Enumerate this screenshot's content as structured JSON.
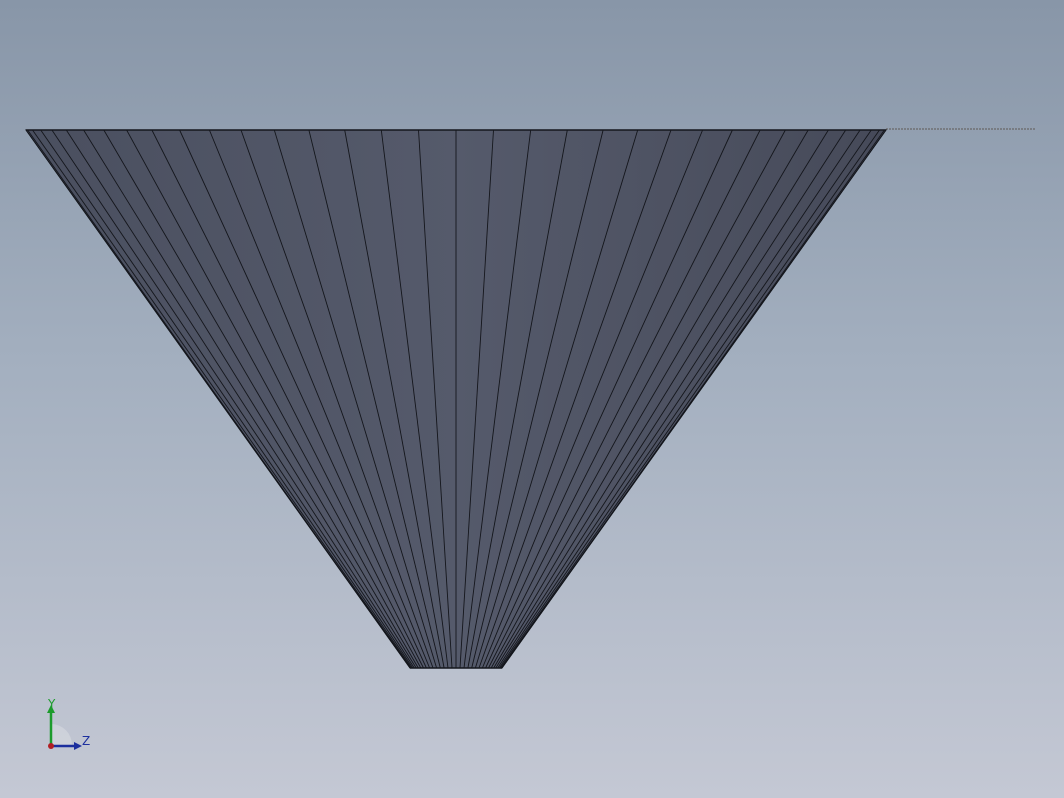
{
  "viewport": {
    "background_top": "#8896a8",
    "background_bottom": "#c4c8d4"
  },
  "model": {
    "shape": "truncated-cone",
    "face_color": "#4f5465",
    "edge_color": "#14161c"
  },
  "triad": {
    "y_label": "Y",
    "z_label": "Z",
    "y_color": "#1c9b2c",
    "z_color": "#1c2f9e",
    "origin_color": "#b01f24"
  }
}
